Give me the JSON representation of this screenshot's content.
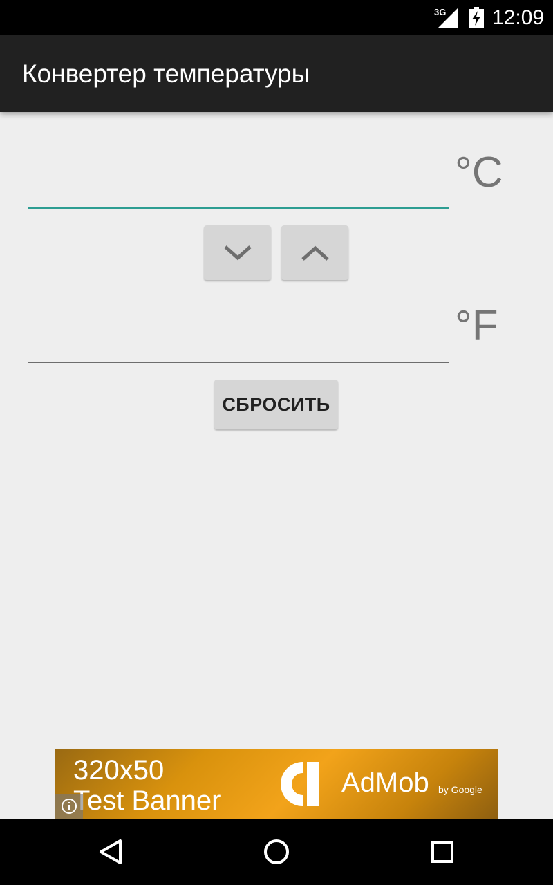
{
  "status_bar": {
    "network": "3G",
    "time": "12:09",
    "icons": [
      "signal-icon",
      "battery-charging-icon"
    ]
  },
  "app_bar": {
    "title": "Конвертер температуры"
  },
  "celsius": {
    "value": "",
    "unit": "°C"
  },
  "fahrenheit": {
    "value": "",
    "unit": "°F"
  },
  "buttons": {
    "down_icon": "chevron-down-icon",
    "up_icon": "chevron-up-icon",
    "reset_label": "СБРОСИТЬ"
  },
  "ad": {
    "size": "320x50",
    "text": "Test Banner",
    "brand": "AdMob",
    "by": "by Google"
  },
  "nav_bar": {
    "icons": [
      "back-icon",
      "home-icon",
      "recent-apps-icon"
    ]
  },
  "colors": {
    "app_bar": "#212121",
    "accent": "#2d9d92",
    "background": "#eeeeee",
    "button": "#d6d6d6"
  }
}
